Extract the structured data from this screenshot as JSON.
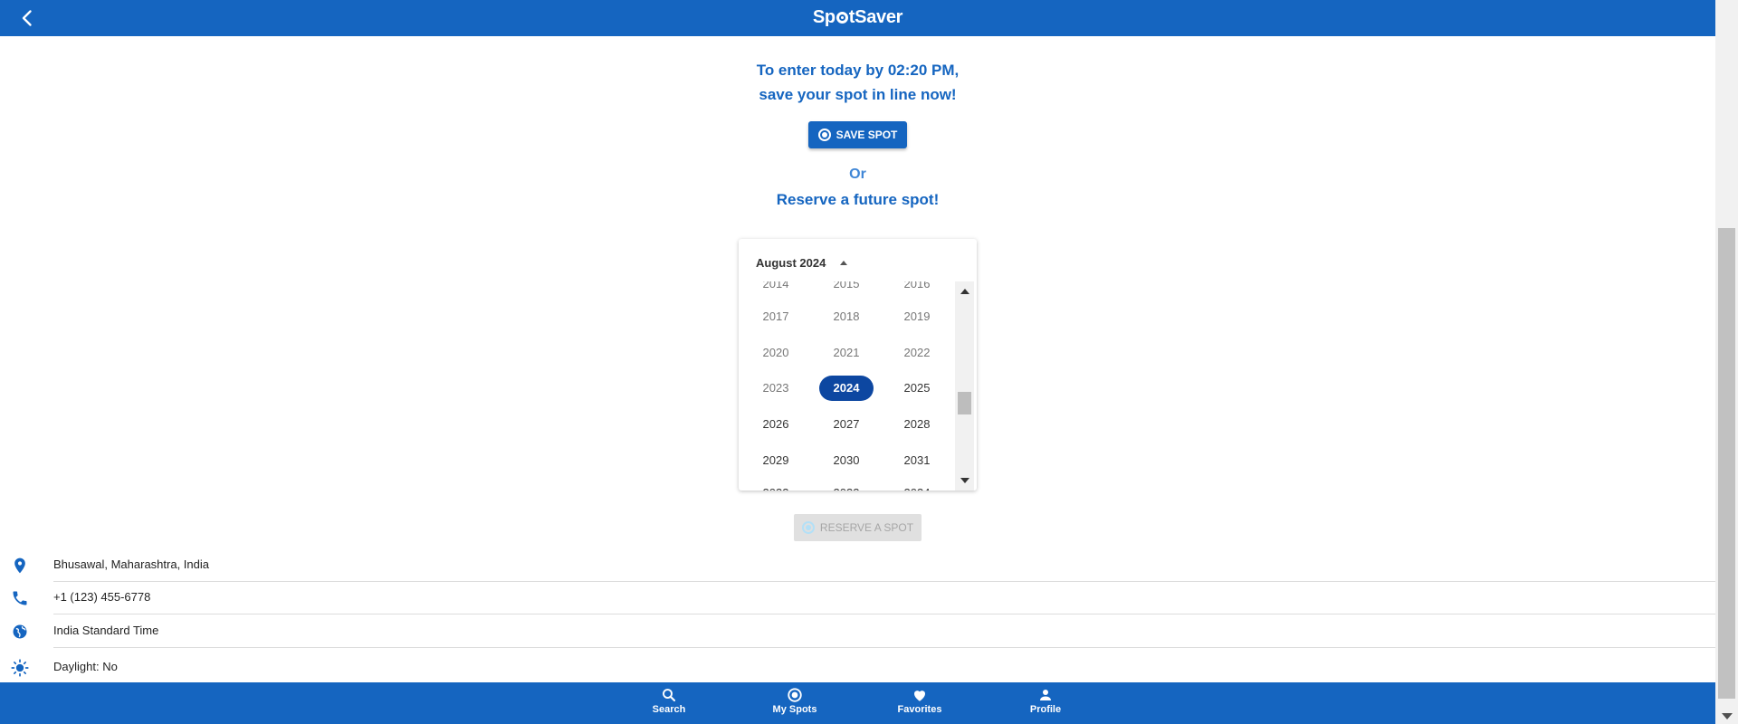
{
  "header": {
    "app_name_part1": "Sp",
    "app_name_part2": "tSaver",
    "logo_icon": "location-ring-icon",
    "back_icon": "chevron-left-icon"
  },
  "intro": {
    "line1": "To enter today by 02:20 PM,",
    "line2": "save your spot in line now!",
    "save_button": "SAVE SPOT",
    "or_text": "Or",
    "reserve_text": "Reserve a future spot!"
  },
  "calendar": {
    "month_label": "August 2024",
    "selected_year": "2024",
    "years_dim": [
      "2017",
      "2018",
      "2019",
      "2020",
      "2021",
      "2022",
      "2023"
    ],
    "years_row_active": [
      "2025"
    ],
    "years_normal": [
      "2026",
      "2027",
      "2028",
      "2029",
      "2030",
      "2031"
    ]
  },
  "reserve_button": "RESERVE A SPOT",
  "info": [
    {
      "icon": "location-pin-icon",
      "text": "Bhusawal, Maharashtra, India"
    },
    {
      "icon": "phone-icon",
      "text": "+1 (123) 455-6778"
    },
    {
      "icon": "globe-icon",
      "text": "India Standard Time"
    },
    {
      "icon": "sun-icon",
      "text": "Daylight: No"
    }
  ],
  "bottom_nav": [
    {
      "icon": "search-icon",
      "label": "Search"
    },
    {
      "icon": "my-spots-icon",
      "label": "My Spots"
    },
    {
      "icon": "heart-icon",
      "label": "Favorites"
    },
    {
      "icon": "person-icon",
      "label": "Profile"
    }
  ],
  "colors": {
    "primary": "#1565c0",
    "selected_year": "#0d47a1"
  }
}
